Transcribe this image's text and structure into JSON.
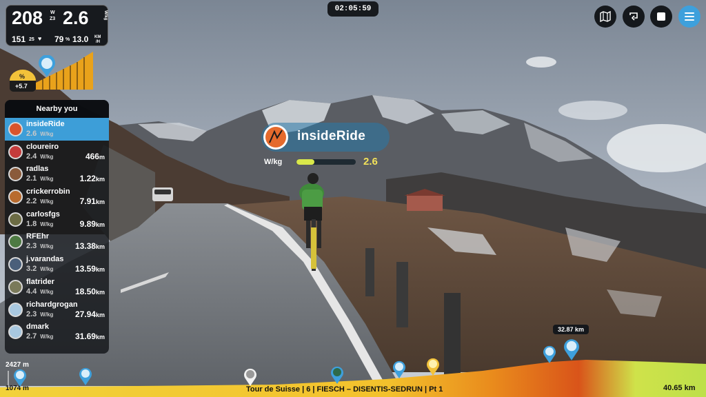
{
  "stats": {
    "power": "208",
    "power_unit_top": "W",
    "zone": "Z3",
    "wkg": "2.6",
    "wkg_unit": "W/kg",
    "cadence": "151",
    "cadence_unit": "25",
    "heart_icon": "heart-icon",
    "hr": "79",
    "hr_unit": "%",
    "speed": "13.0",
    "speed_unit_top": "KM",
    "speed_unit_bottom": "/H"
  },
  "timer": "02:05:59",
  "top_buttons": [
    {
      "icon": "map-icon"
    },
    {
      "icon": "swap-icon"
    },
    {
      "icon": "stop-icon"
    },
    {
      "icon": "menu-icon"
    }
  ],
  "gradient": {
    "label": "%",
    "value": "+5.7"
  },
  "nearby": {
    "title": "Nearby you",
    "wkg_unit": "W/kg",
    "riders": [
      {
        "name": "insideRide",
        "wkg": "2.6",
        "dist": "",
        "unit": "",
        "active": true,
        "color": "#d9542c"
      },
      {
        "name": "cloureiro",
        "wkg": "2.4",
        "dist": "466",
        "unit": "m",
        "active": false,
        "color": "#c43b3b"
      },
      {
        "name": "radlas",
        "wkg": "2.1",
        "dist": "1.22",
        "unit": "km",
        "active": false,
        "color": "#8a5a3a"
      },
      {
        "name": "crickerrobin",
        "wkg": "2.2",
        "dist": "7.91",
        "unit": "km",
        "active": false,
        "color": "#b86b2e"
      },
      {
        "name": "carlosfgs",
        "wkg": "1.8",
        "dist": "9.89",
        "unit": "km",
        "active": false,
        "color": "#6c6c44"
      },
      {
        "name": "RFEhr",
        "wkg": "2.3",
        "dist": "13.38",
        "unit": "km",
        "active": false,
        "color": "#4d7a42"
      },
      {
        "name": "j.varandas",
        "wkg": "3.2",
        "dist": "13.59",
        "unit": "km",
        "active": false,
        "color": "#4a5f7a"
      },
      {
        "name": "flatrider",
        "wkg": "4.4",
        "dist": "18.50",
        "unit": "km",
        "active": false,
        "color": "#7a7a5a"
      },
      {
        "name": "richardgrogan",
        "wkg": "2.3",
        "dist": "27.94",
        "unit": "km",
        "active": false,
        "color": "#a8c8e0"
      },
      {
        "name": "dmark",
        "wkg": "2.7",
        "dist": "31.69",
        "unit": "km",
        "active": false,
        "color": "#a8c8e0"
      }
    ]
  },
  "brand": {
    "name": "insideRide",
    "wkg_label": "W/kg",
    "wkg_value": "2.6",
    "wkg_fill": 0.3
  },
  "elevation": {
    "max": "2427 m",
    "min": "1074 m",
    "remaining": "32.87 km",
    "total": "40.65 km",
    "route": "Tour de Suisse | 6 | FIESCH – DISENTIS-SEDRUN | Pt 1"
  },
  "colors": {
    "accent": "#3ea0dc",
    "panel": "#14161a",
    "highlight": "#f2e25a"
  }
}
